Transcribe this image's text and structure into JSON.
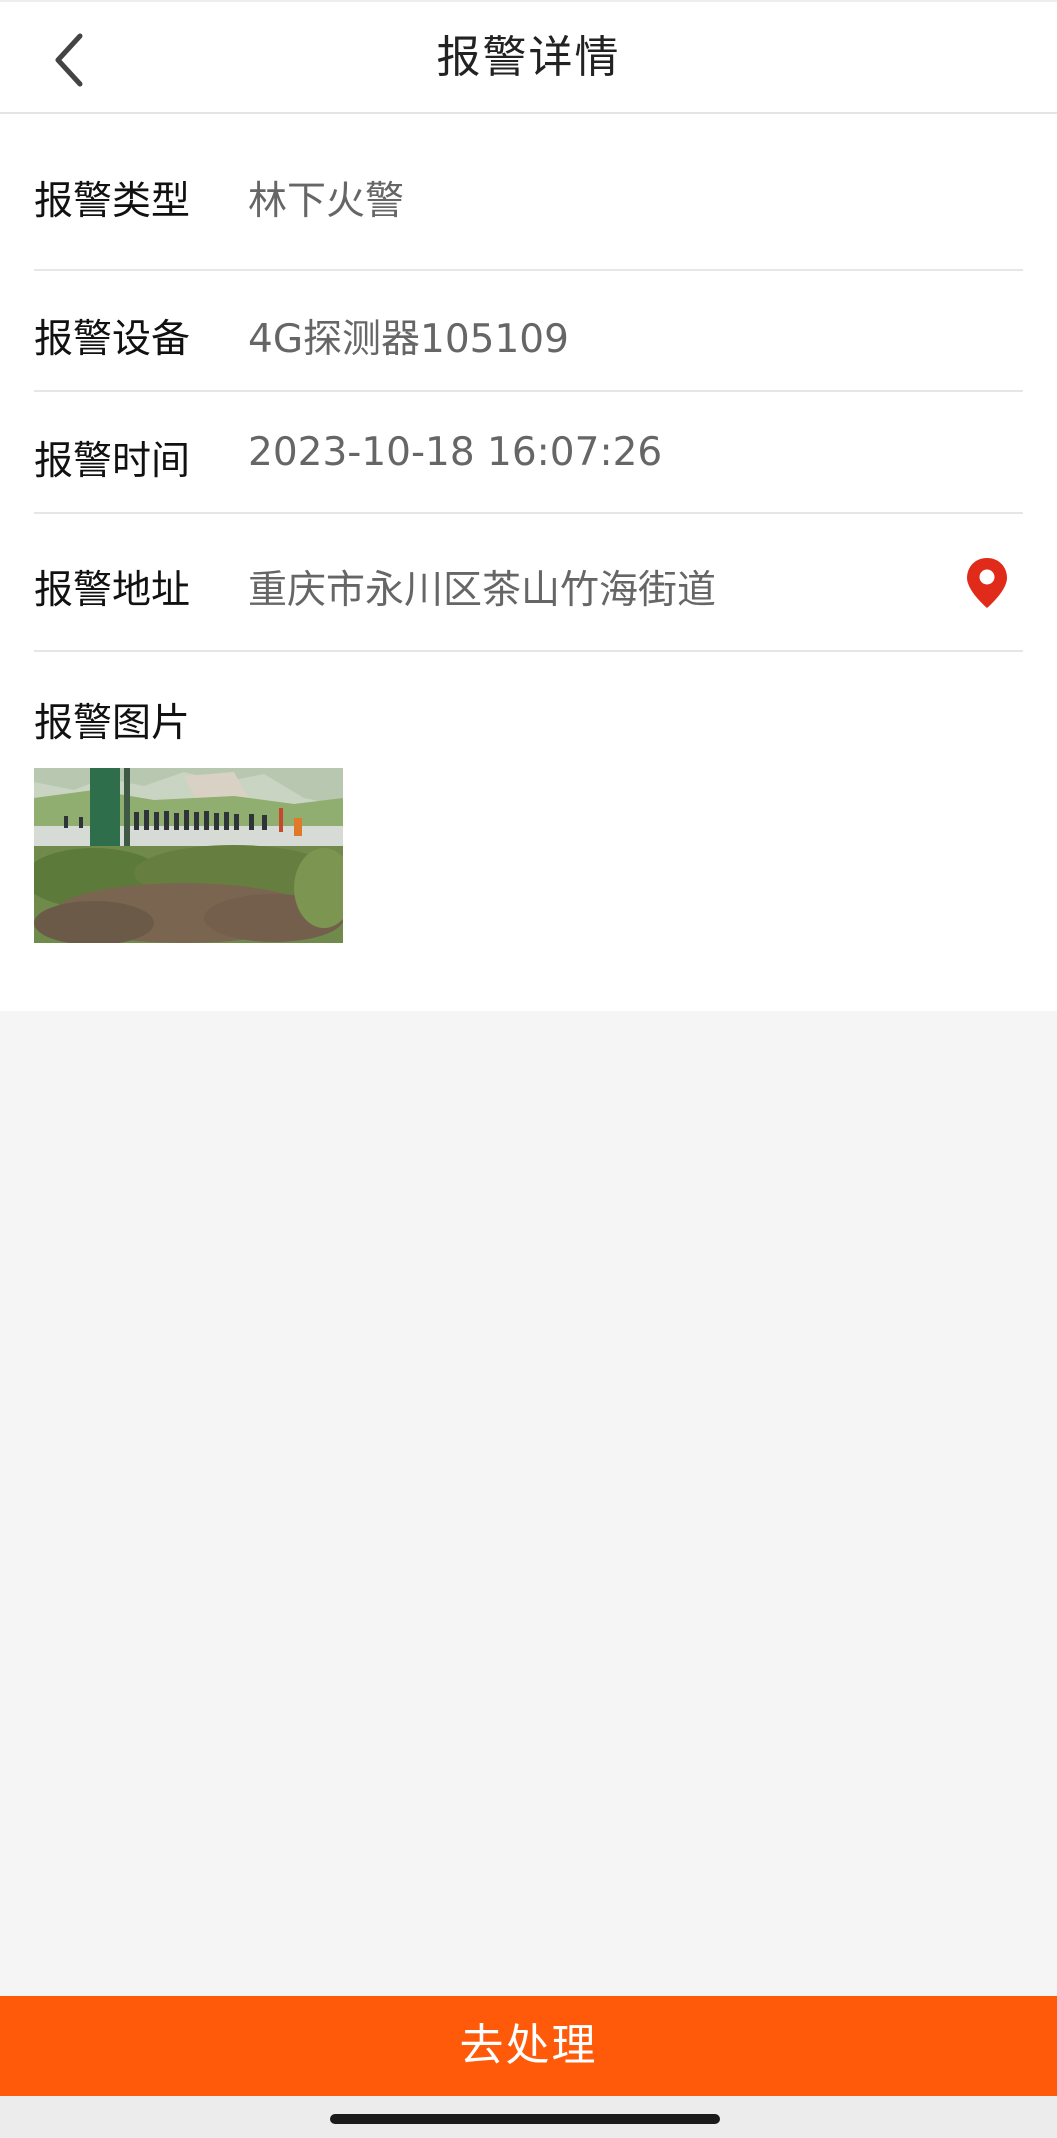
{
  "header": {
    "title": "报警详情",
    "back_icon": "chevron-left-icon"
  },
  "details": [
    {
      "label": "报警类型",
      "value": "林下火警"
    },
    {
      "label": "报警设备",
      "value": "4G探测器105109"
    },
    {
      "label": "报警时间",
      "value": "2023-10-18 16:07:26"
    },
    {
      "label": "报警地址",
      "value": "重庆市永川区茶山竹海街道",
      "icon": "location-pin-icon"
    }
  ],
  "picture": {
    "label": "报警图片"
  },
  "action": {
    "label": "去处理"
  },
  "colors": {
    "accent": "#ff5a0a",
    "pin": "#e02a1a",
    "divider": "#e6e6e6",
    "background": "#f5f5f5"
  }
}
